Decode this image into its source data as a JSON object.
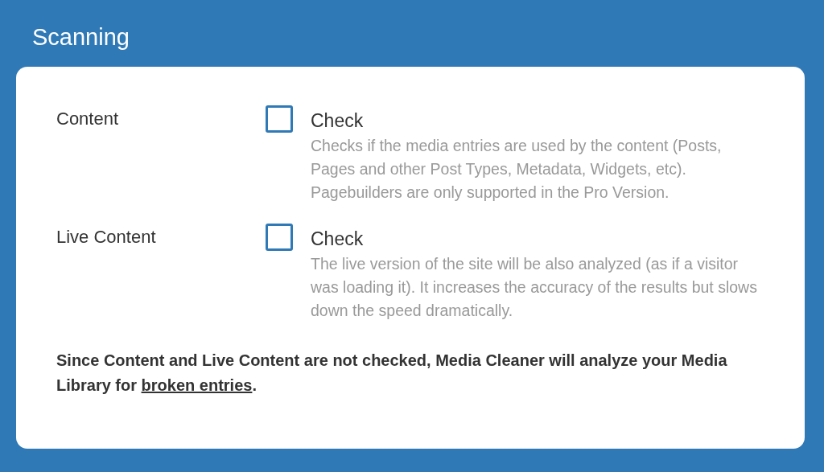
{
  "title": "Scanning",
  "options": [
    {
      "label": "Content",
      "checkbox": {
        "label": "Check",
        "checked": false
      },
      "description": "Checks if the media entries are used by the content (Posts, Pages and other Post Types, Metadata, Widgets, etc). Pagebuilders are only supported in the Pro Version."
    },
    {
      "label": "Live Content",
      "checkbox": {
        "label": "Check",
        "checked": false
      },
      "description": "The live version of the site will be also analyzed (as if a visitor was loading it). It increases the accuracy of the results but slows down the speed dramatically."
    }
  ],
  "note": {
    "text": "Since Content and Live Content are not checked, Media Cleaner will analyze your Media Library for",
    "link": "broken entries",
    "end": "."
  }
}
